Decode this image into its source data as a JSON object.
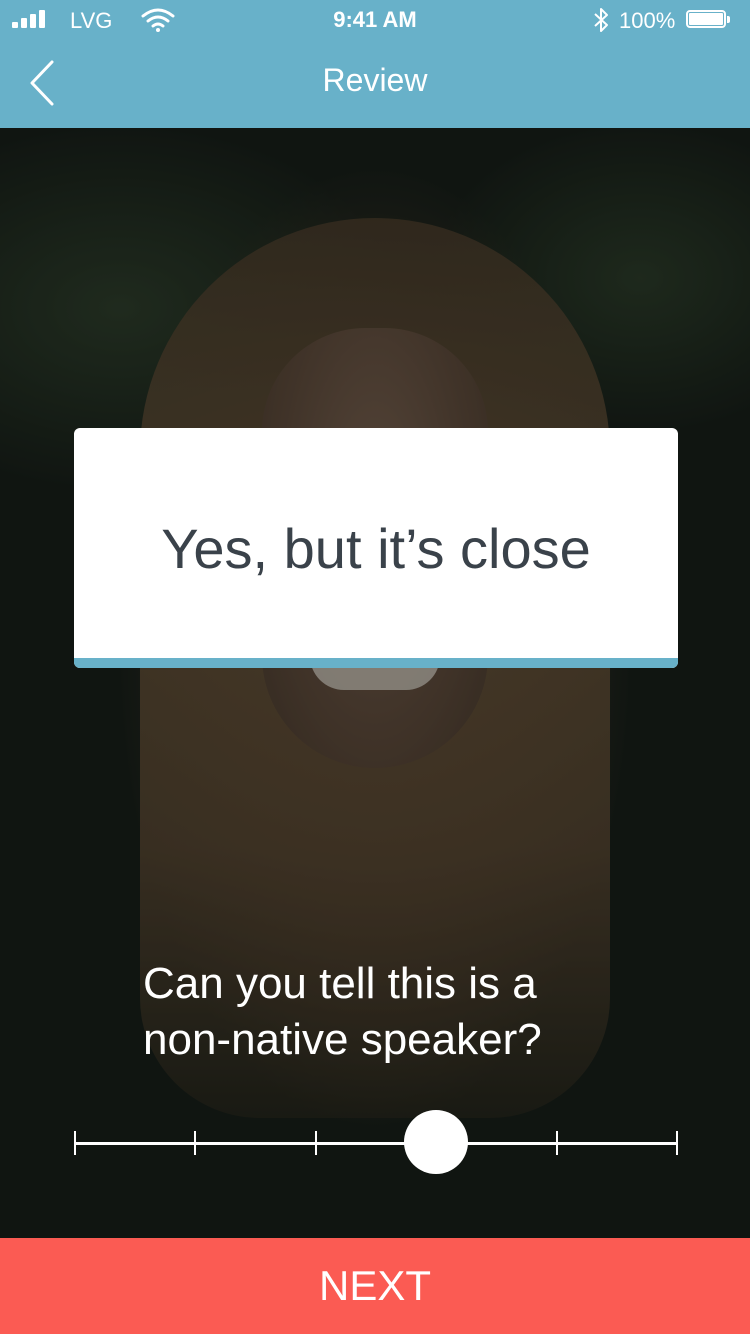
{
  "status_bar": {
    "carrier": "LVG",
    "time": "9:41 AM",
    "battery_percent": "100%",
    "battery_level": 1.0
  },
  "header": {
    "title": "Review",
    "back_icon": "chevron-left-icon"
  },
  "card": {
    "answer": "Yes, but it’s close"
  },
  "question": {
    "line1": "Can you tell this is a",
    "line2": "non-native speaker?"
  },
  "slider": {
    "steps": 6,
    "selected_index": 3
  },
  "footer": {
    "next_label": "NEXT"
  },
  "colors": {
    "accent": "#68b1c9",
    "next_button": "#fb5b53",
    "card_text": "#3a424a"
  }
}
